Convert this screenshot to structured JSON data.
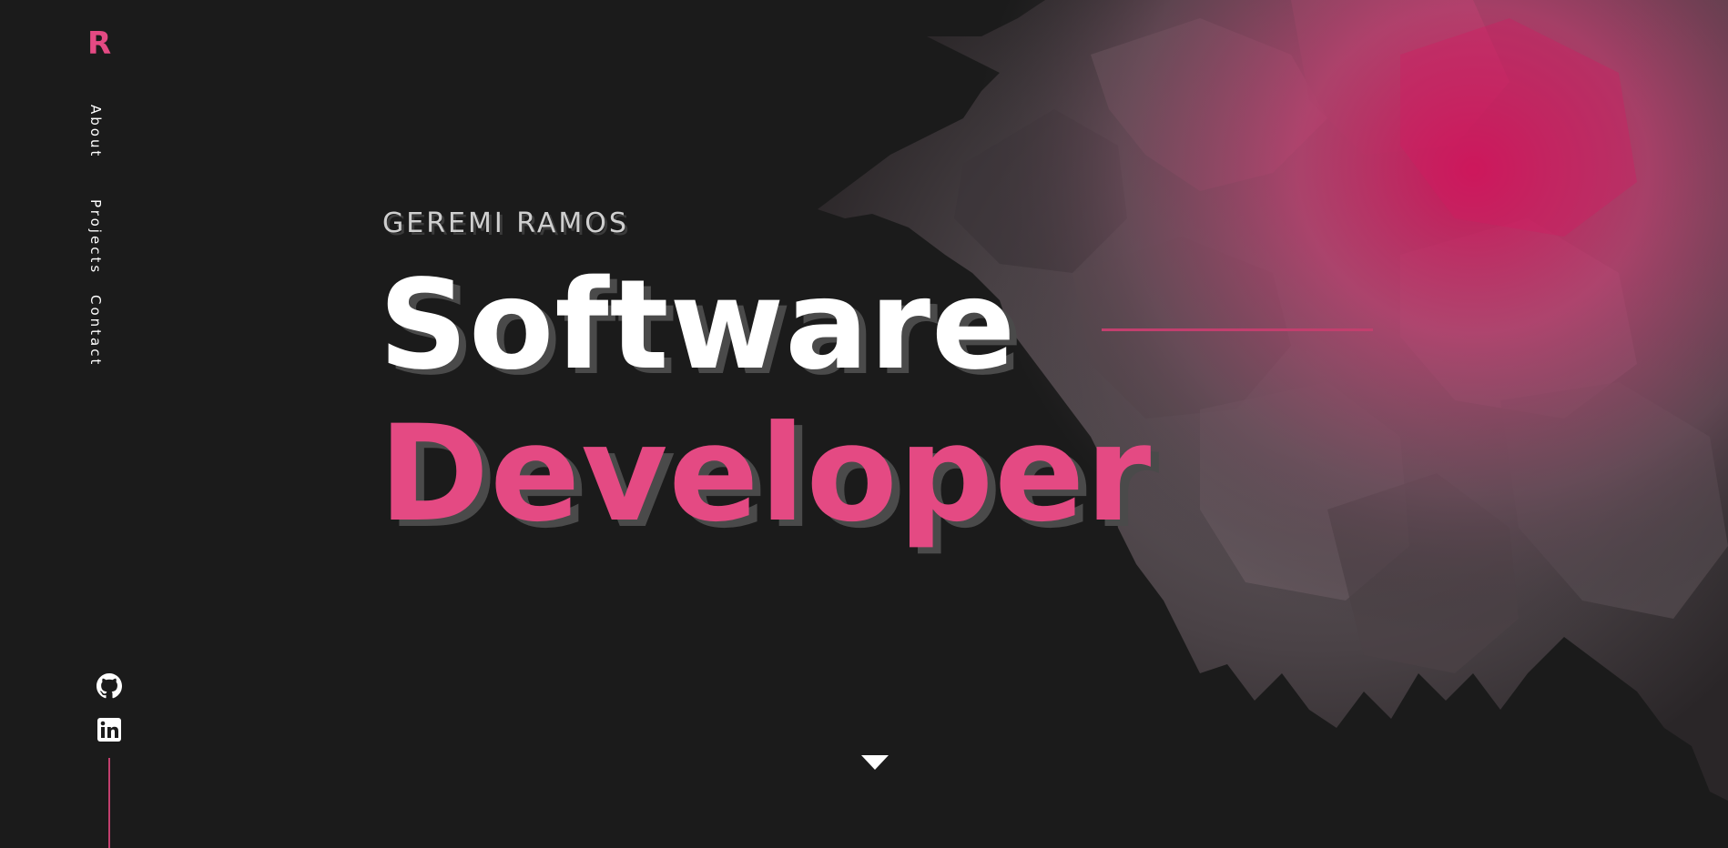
{
  "logo": {
    "text": "R",
    "color": "#e44a83"
  },
  "nav": {
    "items": [
      {
        "label": "About"
      },
      {
        "label": "Projects"
      },
      {
        "label": "Contact"
      }
    ]
  },
  "social": [
    {
      "icon": "github-icon"
    },
    {
      "icon": "linkedin-icon"
    }
  ],
  "hero": {
    "name": "GEREMI RAMOS",
    "title_line1": "Software",
    "title_line2": "Developer"
  },
  "colors": {
    "background": "#1b1b1b",
    "accent": "#e44a83",
    "accent_line": "#c23f6e",
    "text": "#ffffff"
  },
  "scroll_indicator": {
    "icon": "triangle-down-icon"
  }
}
